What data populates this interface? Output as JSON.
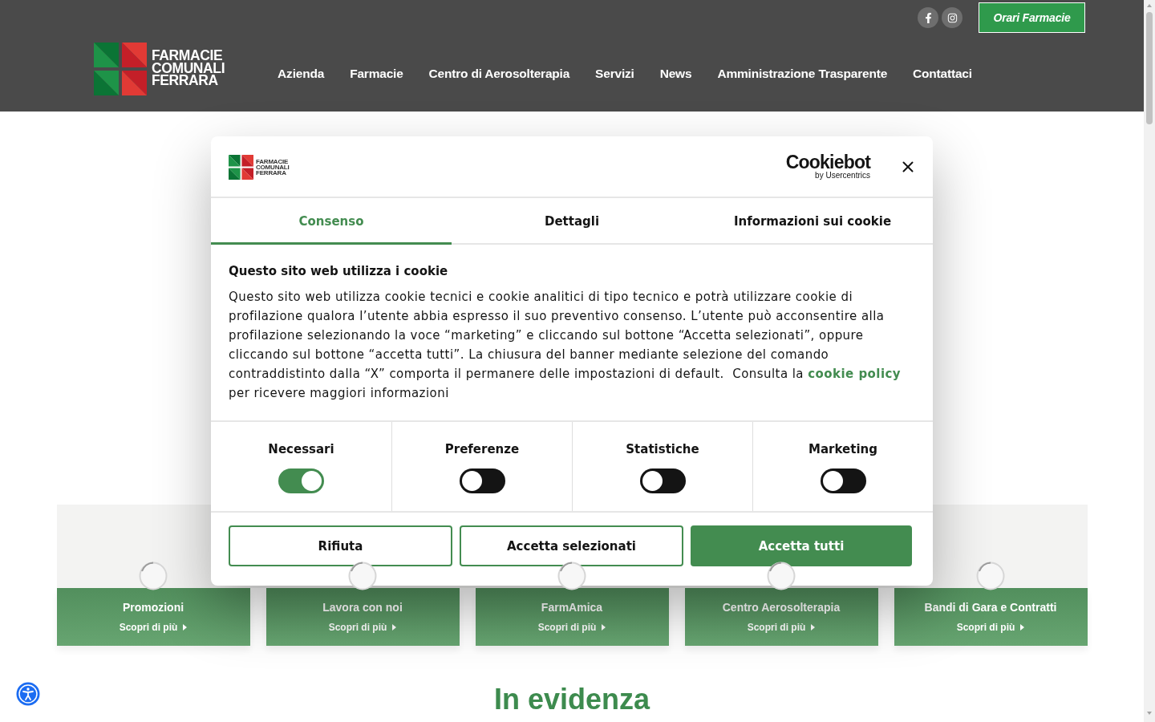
{
  "header": {
    "logo_lines": [
      "FARMACIE",
      "COMUNALI",
      "FERRARA"
    ],
    "hours_button": "Orari Farmacie",
    "nav": [
      "Azienda",
      "Farmacie",
      "Centro di Aerosolterapia",
      "Servizi",
      "News",
      "Amministrazione Trasparente",
      "Contattaci"
    ]
  },
  "cards": [
    {
      "title": "Promozioni",
      "link": "Scopri di più"
    },
    {
      "title": "Lavora con noi",
      "link": "Scopri di più"
    },
    {
      "title": "FarmAmica",
      "link": "Scopri di più"
    },
    {
      "title": "Centro Aerosolterapia",
      "link": "Scopri di più"
    },
    {
      "title": "Bandi di Gara e Contratti",
      "link": "Scopri di più"
    }
  ],
  "section_heading": "In evidenza",
  "cookie_dialog": {
    "logo_lines": [
      "FARMACIE",
      "COMUNALI",
      "FERRARA"
    ],
    "provider_logo": {
      "name": "Cookiebot",
      "tagline": "by Usercentrics"
    },
    "tabs": [
      {
        "label": "Consenso",
        "selected": true
      },
      {
        "label": "Dettagli",
        "selected": false
      },
      {
        "label": "Informazioni sui cookie",
        "selected": false
      }
    ],
    "title": "Questo sito web utilizza i cookie",
    "text_before": "Questo sito web utilizza cookie tecnici e cookie analitici di tipo tecnico e potrà utilizzare cookie di profilazione qualora l’utente abbia espresso il suo preventivo consenso. L’utente può acconsentire alla profilazione selezionando la voce “marketing” e cliccando sul bottone “Accetta selezionati”, oppure cliccando sul bottone “accetta tutti”. La chiusura del banner mediante selezione del comando contraddistinto dalla “X” comporta il permanere delle impostazioni di default.  Consulta la",
    "link": "cookie policy",
    "text_after": "per ricevere maggiori informazioni",
    "categories": [
      {
        "label": "Necessari",
        "checked": true
      },
      {
        "label": "Preferenze",
        "checked": false
      },
      {
        "label": "Statistiche",
        "checked": false
      },
      {
        "label": "Marketing",
        "checked": false
      }
    ],
    "buttons": [
      {
        "label": "Rifiuta",
        "kind": "outline"
      },
      {
        "label": "Accetta selezionati",
        "kind": "outline"
      },
      {
        "label": "Accetta tutti",
        "kind": "filled"
      }
    ]
  }
}
